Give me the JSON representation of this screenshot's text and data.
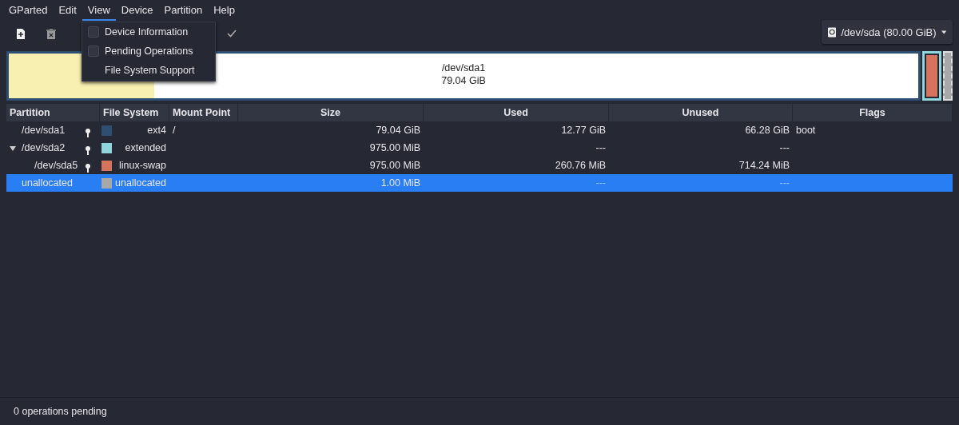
{
  "menubar": [
    {
      "label": "GParted",
      "selected": false
    },
    {
      "label": "Edit",
      "selected": false
    },
    {
      "label": "View",
      "selected": true
    },
    {
      "label": "Device",
      "selected": false
    },
    {
      "label": "Partition",
      "selected": false
    },
    {
      "label": "Help",
      "selected": false
    }
  ],
  "view_menu": [
    {
      "label": "Device Information",
      "kind": "checkbox",
      "checked": false
    },
    {
      "label": "Pending Operations",
      "kind": "checkbox",
      "checked": false
    },
    {
      "label": "File System Support",
      "kind": "plain"
    }
  ],
  "device_selector": {
    "label": "/dev/sda (80.00 GiB)"
  },
  "disk_map": {
    "primary": {
      "name": "/dev/sda1",
      "size": "79.04 GiB",
      "color": "#2f4f72",
      "level": 0.16
    },
    "extended": {
      "color": "#8fd6dc",
      "logical": [
        {
          "color": "#d6735c"
        }
      ]
    },
    "unallocated": {
      "color": "#a8a8a8"
    }
  },
  "table": {
    "columns": [
      "Partition",
      "File System",
      "Mount Point",
      "Size",
      "Used",
      "Unused",
      "Flags"
    ],
    "rows": [
      {
        "partition": "/dev/sda1",
        "locked": true,
        "color": "#2f4f72",
        "file_system": "ext4",
        "mount_point": "/",
        "size": "79.04 GiB",
        "used": "12.77 GiB",
        "unused": "66.28 GiB",
        "flags": "boot",
        "selected": false
      },
      {
        "partition": "/dev/sda2",
        "locked": true,
        "color": "#8fd6dc",
        "file_system": "extended",
        "size": "975.00 MiB",
        "used": "---",
        "unused": "---",
        "selected": false,
        "expanded": true,
        "children": [
          {
            "partition": "/dev/sda5",
            "locked": true,
            "color": "#d6735c",
            "file_system": "linux-swap",
            "size": "975.00 MiB",
            "used": "260.76 MiB",
            "unused": "714.24 MiB",
            "selected": false
          }
        ]
      },
      {
        "partition": "unallocated",
        "locked": false,
        "color": "#a8a8a8",
        "file_system": "unallocated",
        "size": "1.00 MiB",
        "used": "---",
        "unused": "---",
        "selected": true
      }
    ]
  },
  "status_bar": "0 operations pending"
}
